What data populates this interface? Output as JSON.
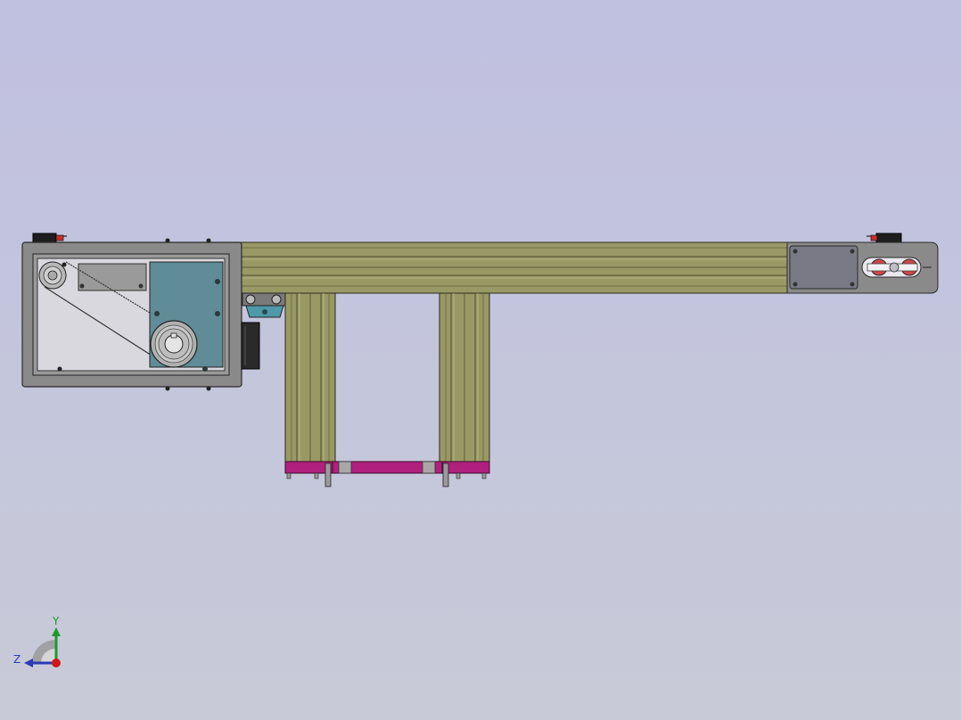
{
  "viewport": {
    "background_top": "#c0c0e0",
    "background_bottom": "#c8cad8"
  },
  "model": {
    "colors": {
      "frame_gray": "#8a8a8a",
      "panel_light": "#d8d8de",
      "cover_teal": "#5f8c96",
      "rail_olive": "#999966",
      "rail_dark": "#6f6f44",
      "rail_light": "#b5b587",
      "foot_magenta": "#b0207e",
      "end_plate_gray": "#7a7a86",
      "sensor_red": "#c8302a",
      "mount_teal": "#4f9aa8"
    }
  },
  "triad": {
    "x_label": "",
    "y_label": "Y",
    "z_label": "Z",
    "y_color": "#1f9a2a",
    "z_color": "#2a3ab8",
    "x_color": "#d01818"
  }
}
